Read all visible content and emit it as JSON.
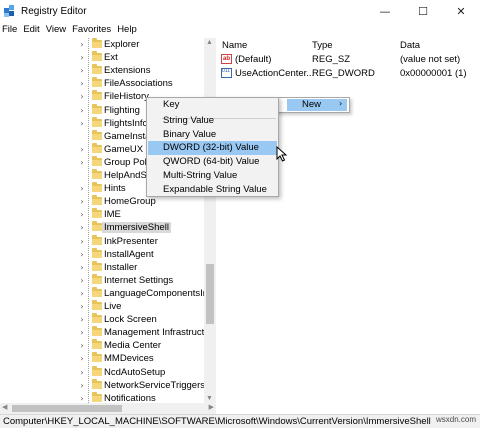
{
  "window": {
    "title": "Registry Editor",
    "controls": [
      "—",
      "☐",
      "✕"
    ]
  },
  "menu": [
    "File",
    "Edit",
    "View",
    "Favorites",
    "Help"
  ],
  "tree": [
    {
      "label": "Explorer",
      "chev": "›"
    },
    {
      "label": "Ext",
      "chev": "›"
    },
    {
      "label": "Extensions",
      "chev": "›"
    },
    {
      "label": "FileAssociations",
      "chev": "›"
    },
    {
      "label": "FileHistory",
      "chev": "›"
    },
    {
      "label": "Flighting",
      "chev": "›"
    },
    {
      "label": "FlightsInfo",
      "chev": "›"
    },
    {
      "label": "GameInsta",
      "chev": ""
    },
    {
      "label": "GameUX",
      "chev": "›"
    },
    {
      "label": "Group Pol",
      "chev": "›"
    },
    {
      "label": "HelpAndSu",
      "chev": ""
    },
    {
      "label": "Hints",
      "chev": "›"
    },
    {
      "label": "HomeGroup",
      "chev": "›"
    },
    {
      "label": "IME",
      "chev": "›"
    },
    {
      "label": "ImmersiveShell",
      "chev": "›",
      "selected": true
    },
    {
      "label": "InkPresenter",
      "chev": "›"
    },
    {
      "label": "InstallAgent",
      "chev": "›"
    },
    {
      "label": "Installer",
      "chev": "›"
    },
    {
      "label": "Internet Settings",
      "chev": "›"
    },
    {
      "label": "LanguageComponentsIns",
      "chev": "›"
    },
    {
      "label": "Live",
      "chev": "›"
    },
    {
      "label": "Lock Screen",
      "chev": "›"
    },
    {
      "label": "Management Infrastructu",
      "chev": "›"
    },
    {
      "label": "Media Center",
      "chev": "›"
    },
    {
      "label": "MMDevices",
      "chev": "›"
    },
    {
      "label": "NcdAutoSetup",
      "chev": "›"
    },
    {
      "label": "NetworkServiceTriggers",
      "chev": "›"
    },
    {
      "label": "Notifications",
      "chev": "›"
    }
  ],
  "values_pane": {
    "columns": {
      "name": "Name",
      "type": "Type",
      "data": "Data"
    },
    "rows": [
      {
        "icon": "string-value-icon",
        "icon_text": "ab",
        "name": "(Default)",
        "type": "REG_SZ",
        "data": "(value not set)"
      },
      {
        "icon": "binary-value-icon",
        "icon_text": "011 110",
        "name": "UseActionCenter...",
        "type": "REG_DWORD",
        "data": "0x00000001 (1)"
      }
    ]
  },
  "context_menu": {
    "new_label": "New",
    "arrow": "›"
  },
  "submenu": {
    "items": [
      "Key",
      "String Value",
      "Binary Value",
      "DWORD (32-bit) Value",
      "QWORD (64-bit) Value",
      "Multi-String Value",
      "Expandable String Value"
    ],
    "highlighted_index": 3
  },
  "status": "Computer\\HKEY_LOCAL_MACHINE\\SOFTWARE\\Microsoft\\Windows\\CurrentVersion\\ImmersiveShell",
  "watermark": "wsxdn.com",
  "colors": {
    "highlight": "#99c8f3",
    "folder": "#e8c25a",
    "selected": "#d9d9d9"
  }
}
